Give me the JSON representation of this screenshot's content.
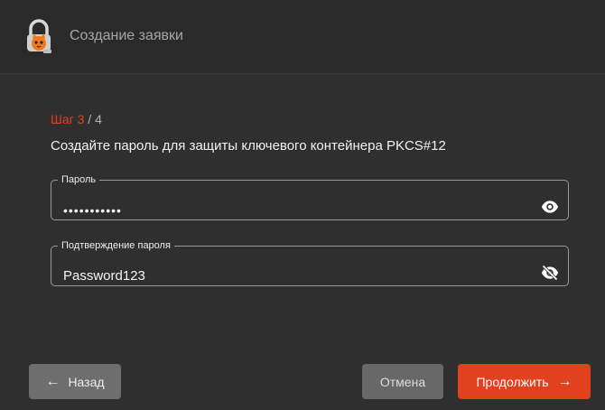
{
  "header": {
    "title": "Создание заявки",
    "logo_icon": "padlock-cat-icon"
  },
  "wizard": {
    "step_prefix": "Шаг 3",
    "step_suffix": " / 4",
    "heading": "Создайте пароль для защиты ключевого контейнера PKCS#12"
  },
  "password_field": {
    "label": "Пароль",
    "value": "•••••••••••",
    "toggle_icon": "eye-icon"
  },
  "confirm_field": {
    "label": "Подтверждение пароля",
    "value": "Password123",
    "toggle_icon": "eye-off-icon"
  },
  "buttons": {
    "back": {
      "label": "Назад",
      "icon": "arrow-left-icon"
    },
    "cancel": {
      "label": "Отмена"
    },
    "next": {
      "label": "Продолжить",
      "icon": "arrow-right-icon"
    }
  },
  "colors": {
    "accent": "#e2411f",
    "background": "#2f2f2f",
    "header": "#2a2a2a"
  }
}
